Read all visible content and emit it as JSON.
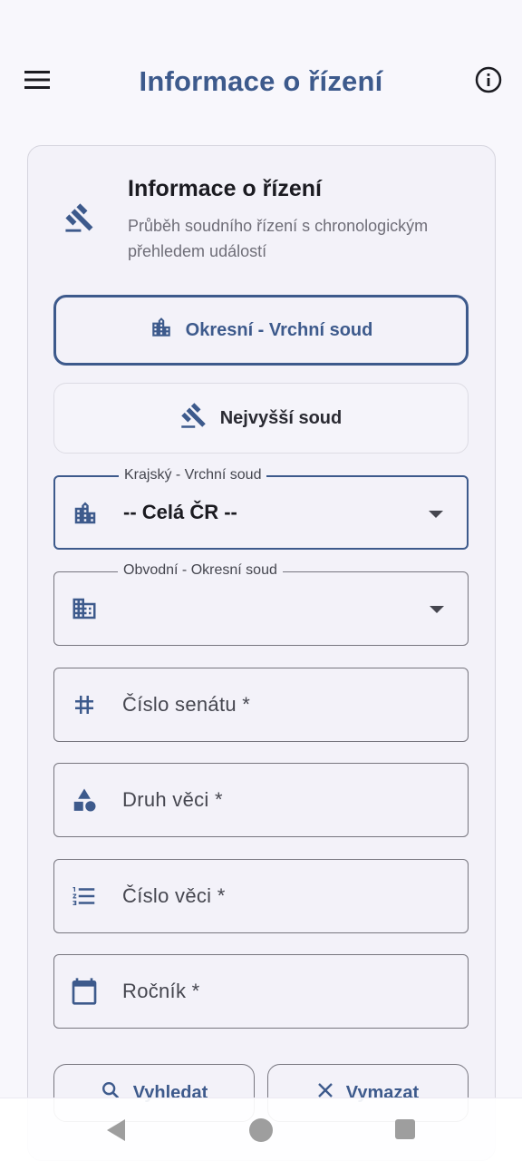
{
  "app_bar": {
    "title": "Informace o řízení",
    "menu_icon": "menu-icon",
    "info_icon": "info-icon"
  },
  "card": {
    "title": "Informace o řízení",
    "subtitle": "Průběh soudního řízení s chronologickým přehledem událostí",
    "icon": "gavel-icon"
  },
  "court_selector": {
    "options": [
      {
        "label": "Okresní - Vrchní soud",
        "icon": "building-icon",
        "selected": true
      },
      {
        "label": "Nejvyšší soud",
        "icon": "gavel-icon",
        "selected": false
      }
    ]
  },
  "form": {
    "regional_court": {
      "label": "Krajský - Vrchní soud",
      "value": "-- Celá ČR --",
      "icon": "building-icon"
    },
    "district_court": {
      "label": "Obvodní - Okresní soud",
      "value": "",
      "icon": "building-alt-icon"
    },
    "senate_number": {
      "placeholder": "Číslo senátu *",
      "icon": "hash-icon"
    },
    "case_type": {
      "placeholder": "Druh věci *",
      "icon": "shapes-icon"
    },
    "case_number": {
      "placeholder": "Číslo věci *",
      "icon": "numbered-list-icon"
    },
    "year": {
      "placeholder": "Ročník *",
      "icon": "calendar-icon"
    }
  },
  "actions": {
    "search_label": "Vyhledat",
    "clear_label": "Vymazat"
  },
  "colors": {
    "accent": "#3d5a8c",
    "background": "#f8f7fc",
    "card": "#f3f2f9"
  }
}
